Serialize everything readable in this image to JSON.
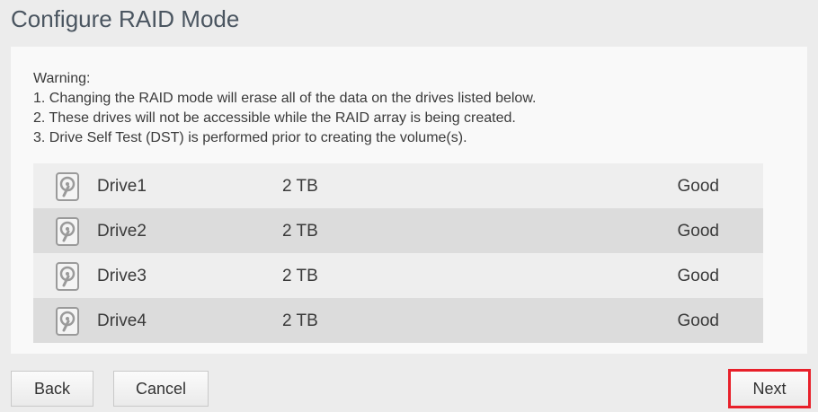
{
  "page": {
    "title": "Configure RAID Mode"
  },
  "warning": {
    "heading": "Warning:",
    "lines": [
      "1. Changing the RAID mode will erase all of the data on the drives listed below.",
      "2. These drives will not be accessible while the RAID array is being created.",
      "3. Drive Self Test (DST) is performed prior to creating the volume(s)."
    ]
  },
  "drives": [
    {
      "icon": "hard-drive-icon",
      "name": "Drive1",
      "size": "2 TB",
      "status": "Good"
    },
    {
      "icon": "hard-drive-icon",
      "name": "Drive2",
      "size": "2 TB",
      "status": "Good"
    },
    {
      "icon": "hard-drive-icon",
      "name": "Drive3",
      "size": "2 TB",
      "status": "Good"
    },
    {
      "icon": "hard-drive-icon",
      "name": "Drive4",
      "size": "2 TB",
      "status": "Good"
    }
  ],
  "buttons": {
    "back": "Back",
    "cancel": "Cancel",
    "next": "Next"
  },
  "colors": {
    "highlight": "#e8202a",
    "row_light": "#eeeeee",
    "row_dark": "#dcdcdc",
    "title": "#4a5560"
  }
}
